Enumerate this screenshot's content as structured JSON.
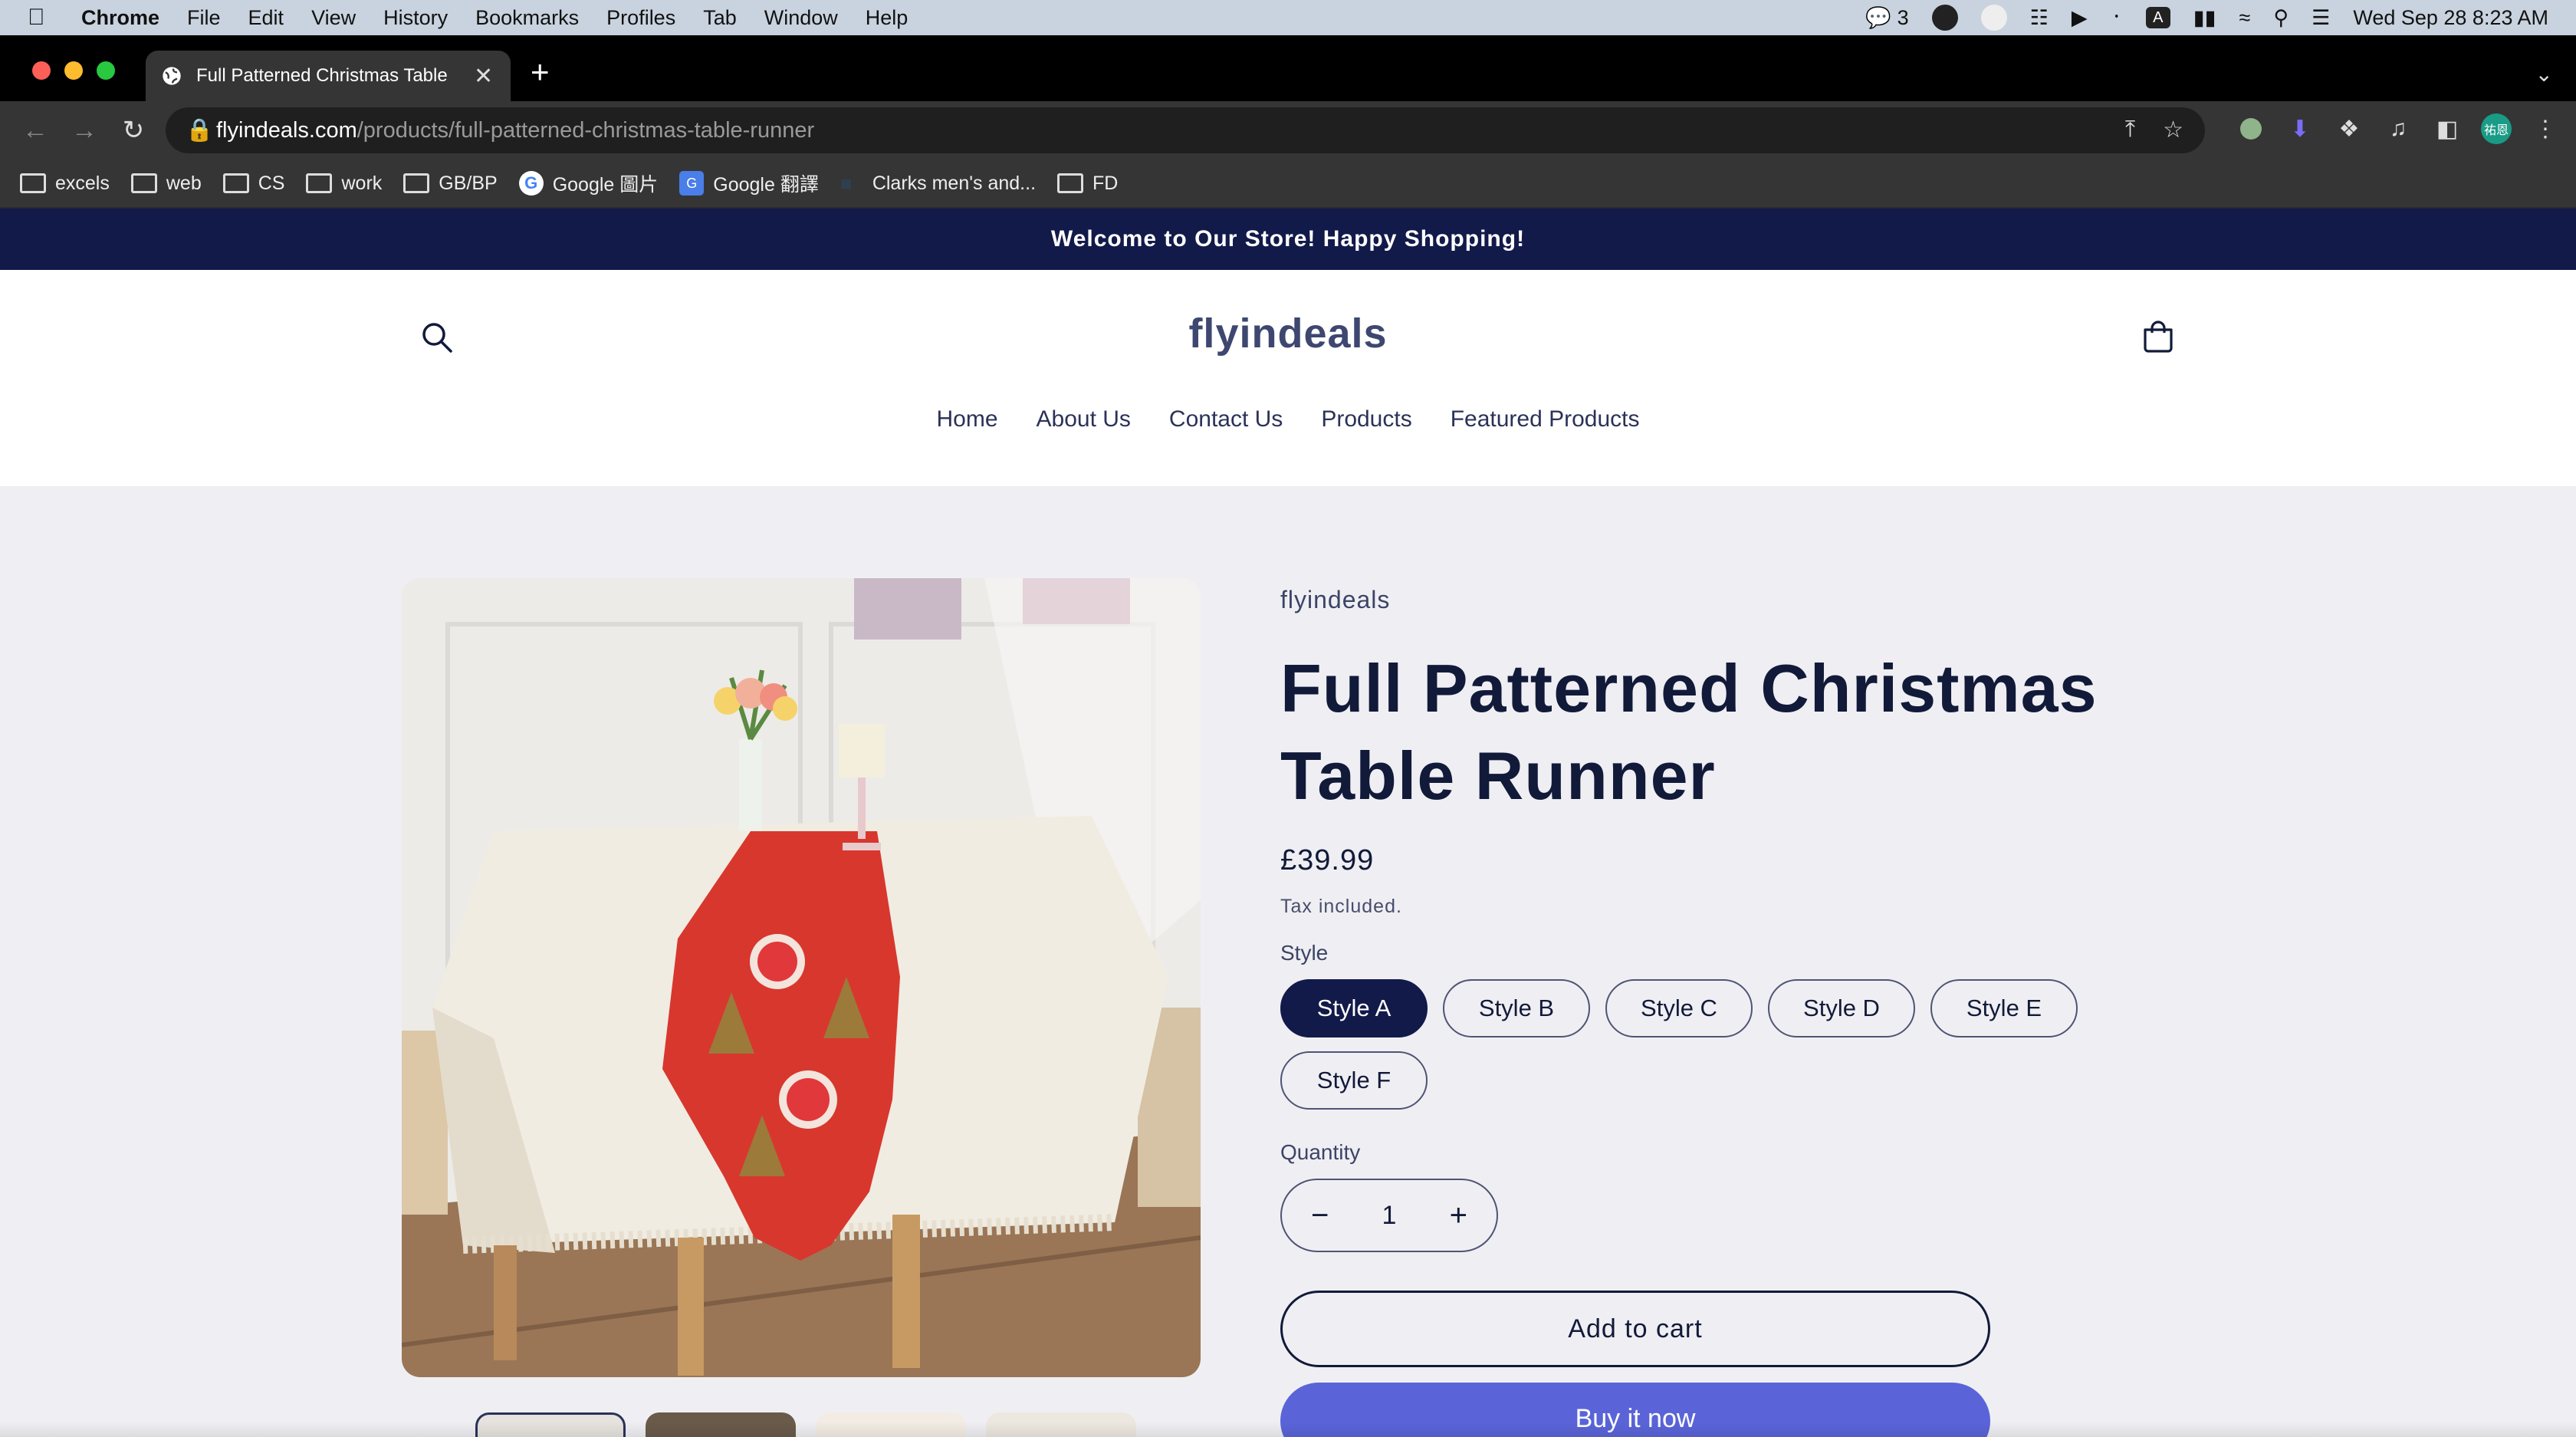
{
  "menubar": {
    "app": "Chrome",
    "items": [
      "File",
      "Edit",
      "View",
      "History",
      "Bookmarks",
      "Profiles",
      "Tab",
      "Window",
      "Help"
    ],
    "wechat_count": "3",
    "input_source": "A",
    "datetime": "Wed Sep 28  8:23 AM"
  },
  "browser": {
    "tab_title": "Full Patterned Christmas Table",
    "url_host": "flyindeals.com",
    "url_path": "/products/full-patterned-christmas-table-runner",
    "avatar_text": "祐恩",
    "bookmarks": [
      {
        "label": "excels",
        "icon": "folder-icon"
      },
      {
        "label": "web",
        "icon": "folder-icon"
      },
      {
        "label": "CS",
        "icon": "folder-icon"
      },
      {
        "label": "work",
        "icon": "folder-icon"
      },
      {
        "label": "GB/BP",
        "icon": "folder-icon"
      },
      {
        "label": "Google 圖片",
        "icon": "google-icon"
      },
      {
        "label": "Google 翻譯",
        "icon": "translate-icon"
      },
      {
        "label": "Clarks men's and...",
        "icon": "clarks-icon"
      },
      {
        "label": "FD",
        "icon": "folder-icon"
      }
    ]
  },
  "store": {
    "announcement": "Welcome to Our Store! Happy Shopping!",
    "logo": "flyindeals",
    "nav": [
      "Home",
      "About Us",
      "Contact Us",
      "Products",
      "Featured Products"
    ]
  },
  "product": {
    "vendor": "flyindeals",
    "title": "Full Patterned Christmas Table Runner",
    "price": "£39.99",
    "tax_note": "Tax included.",
    "style_label": "Style",
    "styles": [
      "Style A",
      "Style B",
      "Style C",
      "Style D",
      "Style E",
      "Style F"
    ],
    "selected_style": "Style A",
    "quantity_label": "Quantity",
    "quantity": "1",
    "add_to_cart": "Add to cart",
    "buy_now": "Buy it now"
  },
  "colors": {
    "announcement_bg": "#121a4a",
    "accent": "#121a4a",
    "buy_now_bg": "#5a64d8",
    "page_bg": "#efeff3"
  }
}
